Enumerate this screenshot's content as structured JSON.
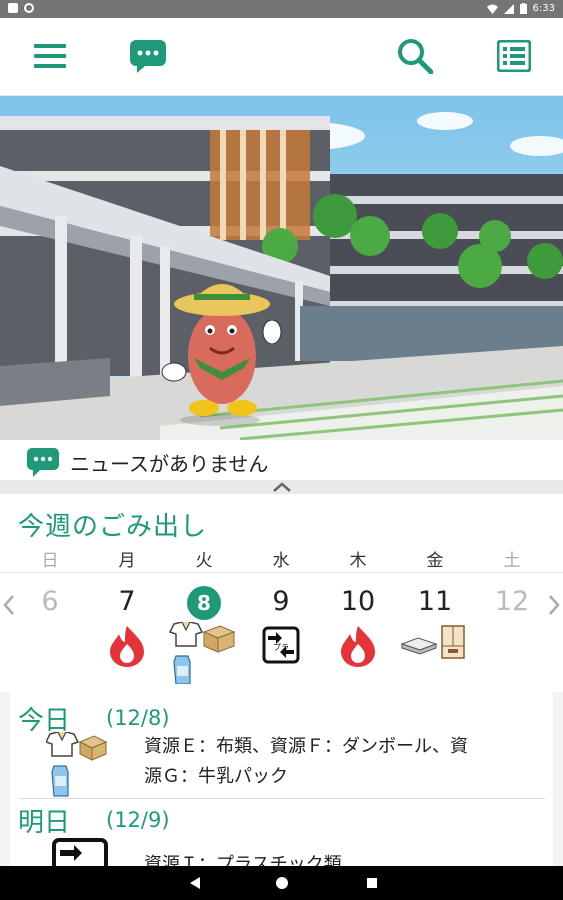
{
  "status_bar": {
    "time": "6:33"
  },
  "appbar": {
    "icons": [
      "menu-icon",
      "chat-icon",
      "search-icon",
      "list-icon"
    ]
  },
  "news": {
    "text": "ニュースがありません"
  },
  "weekly": {
    "title": "今週のごみ出し",
    "days_of_week": [
      "日",
      "月",
      "火",
      "水",
      "木",
      "金",
      "土"
    ],
    "dates": [
      "6",
      "7",
      "8",
      "9",
      "10",
      "11",
      "12"
    ],
    "today_index": 2,
    "day_icons": [
      [],
      [
        "burnable-fire-icon"
      ],
      [
        "clothes-icon",
        "cardboard-icon",
        "milk-carton-icon"
      ],
      [
        "plastic-recycle-icon"
      ],
      [
        "burnable-fire-icon"
      ],
      [
        "newspaper-icon",
        "cabinet-icon"
      ],
      []
    ]
  },
  "detail": {
    "today": {
      "label": "今日",
      "date": "(12/8)",
      "desc_line1": "資源Ｅ：布類、資源Ｆ：ダンボール、資",
      "desc_line2": "源Ｇ：牛乳パック"
    },
    "tomorrow": {
      "label": "明日",
      "date": "(12/9)",
      "desc_line1": "資源Ｉ：プラスチック類"
    }
  },
  "colors": {
    "accent": "#1e9a78",
    "fire": "#e5333a"
  }
}
